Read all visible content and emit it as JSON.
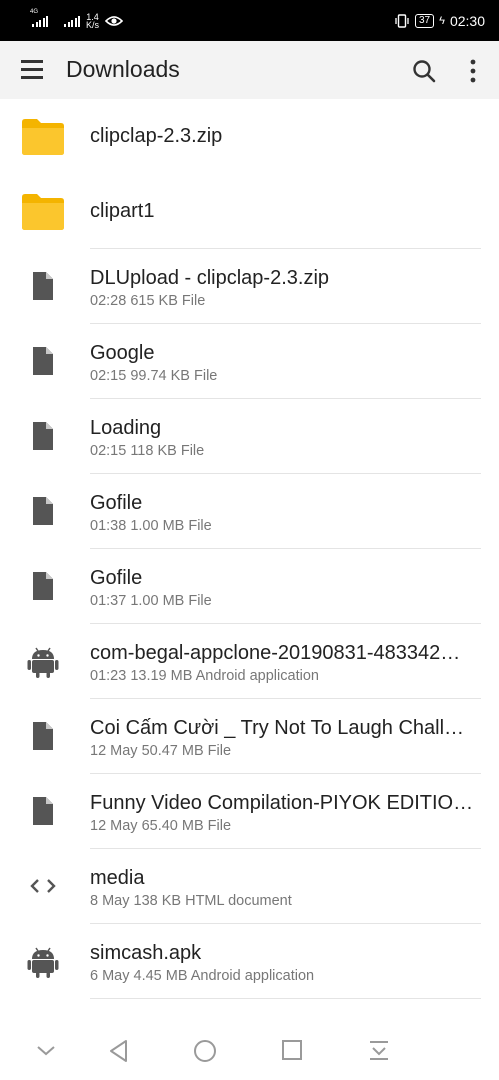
{
  "status_bar": {
    "network_1": "4G",
    "net_speed_value": "1.4",
    "net_speed_unit": "K/s",
    "battery": "37",
    "time": "02:30"
  },
  "app_bar": {
    "title": "Downloads",
    "icons": [
      "menu-icon",
      "search-icon",
      "more-vert-icon"
    ]
  },
  "files": [
    {
      "name": "clipclap-2.3.zip",
      "meta": "",
      "icon": "folder-icon"
    },
    {
      "name": "clipart1",
      "meta": "",
      "icon": "folder-icon"
    },
    {
      "name": "DLUpload - clipclap-2.3.zip",
      "meta": "02:28 615 KB File",
      "icon": "file-icon"
    },
    {
      "name": "Google",
      "meta": "02:15 99.74 KB File",
      "icon": "file-icon"
    },
    {
      "name": "Loading",
      "meta": "02:15 118 KB File",
      "icon": "file-icon"
    },
    {
      "name": "Gofile",
      "meta": "01:38 1.00 MB File",
      "icon": "file-icon"
    },
    {
      "name": "Gofile",
      "meta": "01:37 1.00 MB File",
      "icon": "file-icon"
    },
    {
      "name": "com-begal-appclone-20190831-483342…",
      "meta": "01:23 13.19 MB Android application",
      "icon": "android-icon"
    },
    {
      "name": "Coi Cấm Cười _ Try Not To Laugh Chall…",
      "meta": "12 May 50.47 MB File",
      "icon": "file-icon"
    },
    {
      "name": "Funny Video Compilation-PIYOK EDITIO…",
      "meta": "12 May 65.40 MB File",
      "icon": "file-icon"
    },
    {
      "name": "media",
      "meta": "8 May 138 KB HTML document",
      "icon": "code-icon"
    },
    {
      "name": "simcash.apk",
      "meta": "6 May 4.45 MB Android application",
      "icon": "android-icon"
    }
  ],
  "nav_bar": {
    "icons": [
      "collapse-icon",
      "back-icon",
      "home-icon",
      "recents-icon",
      "notification-pull-icon"
    ]
  },
  "colors": {
    "status_bar": "#000000",
    "app_bar": "#f3f3f3",
    "folder": "#fbc02d",
    "icon_grey": "#555555",
    "secondary_text": "#777777"
  }
}
